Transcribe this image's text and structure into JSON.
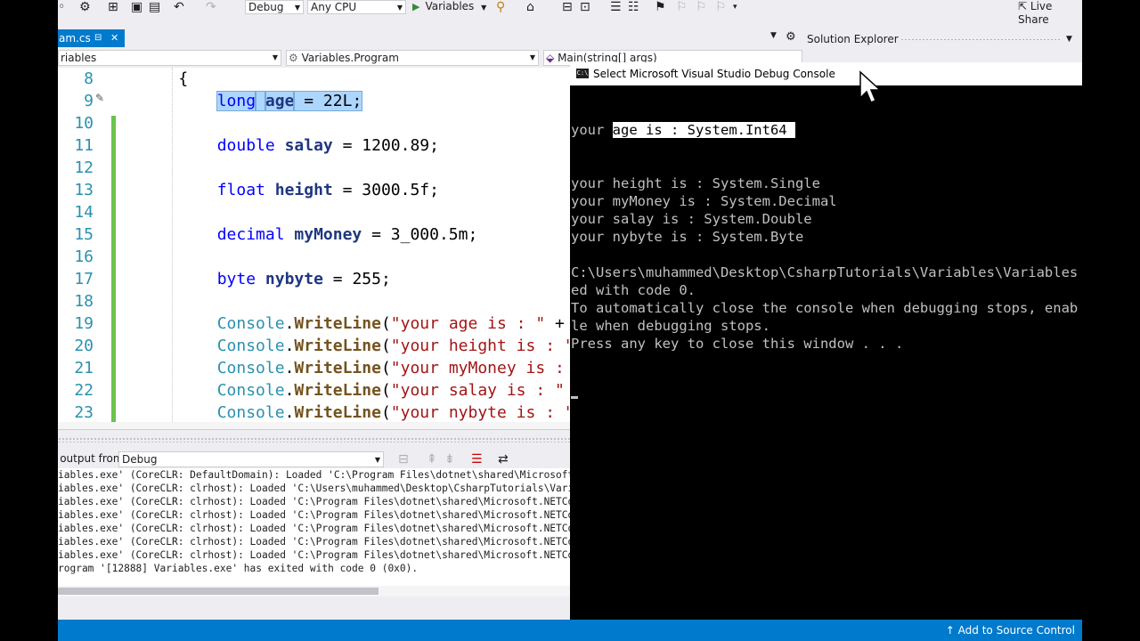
{
  "toolbar": {
    "config": "Debug",
    "platform": "Any CPU",
    "start_label": "Variables",
    "live_share": "Live Share"
  },
  "tabs": {
    "active_tab": "am.cs",
    "pin": "⊟",
    "close": "✕"
  },
  "navbar": {
    "project": "riables",
    "type": "Variables.Program",
    "member": "Main(string[] args)"
  },
  "editor": {
    "line_numbers": [
      "8",
      "9",
      "10",
      "11",
      "12",
      "13",
      "14",
      "15",
      "16",
      "17",
      "18",
      "19",
      "20",
      "21",
      "22",
      "23"
    ],
    "lines": [
      {
        "parts": [
          {
            "t": "    {",
            "c": ""
          }
        ]
      },
      {
        "parts": [
          {
            "t": "        ",
            "c": ""
          },
          {
            "t": "long",
            "c": "kw sel"
          },
          {
            "t": " ",
            "c": "sel"
          },
          {
            "t": "age",
            "c": "var sel"
          },
          {
            "t": " = 22L;",
            "c": "sel"
          }
        ]
      },
      {
        "parts": [
          {
            "t": "",
            "c": ""
          }
        ]
      },
      {
        "parts": [
          {
            "t": "        ",
            "c": ""
          },
          {
            "t": "double",
            "c": "kw"
          },
          {
            "t": " ",
            "c": ""
          },
          {
            "t": "salay",
            "c": "var"
          },
          {
            "t": " = 1200.89;",
            "c": ""
          }
        ]
      },
      {
        "parts": [
          {
            "t": "",
            "c": ""
          }
        ]
      },
      {
        "parts": [
          {
            "t": "        ",
            "c": ""
          },
          {
            "t": "float",
            "c": "kw"
          },
          {
            "t": " ",
            "c": ""
          },
          {
            "t": "height",
            "c": "var"
          },
          {
            "t": " = 3000.5f;",
            "c": ""
          }
        ]
      },
      {
        "parts": [
          {
            "t": "",
            "c": ""
          }
        ]
      },
      {
        "parts": [
          {
            "t": "        ",
            "c": ""
          },
          {
            "t": "decimal",
            "c": "kw"
          },
          {
            "t": " ",
            "c": ""
          },
          {
            "t": "myMoney",
            "c": "var"
          },
          {
            "t": " = 3_000.5m;",
            "c": ""
          }
        ]
      },
      {
        "parts": [
          {
            "t": "",
            "c": ""
          }
        ]
      },
      {
        "parts": [
          {
            "t": "        ",
            "c": ""
          },
          {
            "t": "byte",
            "c": "kw"
          },
          {
            "t": " ",
            "c": ""
          },
          {
            "t": "nybyte",
            "c": "var"
          },
          {
            "t": " = 255;",
            "c": ""
          }
        ]
      },
      {
        "parts": [
          {
            "t": "",
            "c": ""
          }
        ]
      },
      {
        "parts": [
          {
            "t": "        ",
            "c": ""
          },
          {
            "t": "Console",
            "c": "cls"
          },
          {
            "t": ".",
            "c": ""
          },
          {
            "t": "WriteLine",
            "c": "mth"
          },
          {
            "t": "(",
            "c": ""
          },
          {
            "t": "\"your age is : \"",
            "c": "str"
          },
          {
            "t": " +",
            "c": ""
          }
        ]
      },
      {
        "parts": [
          {
            "t": "        ",
            "c": ""
          },
          {
            "t": "Console",
            "c": "cls"
          },
          {
            "t": ".",
            "c": ""
          },
          {
            "t": "WriteLine",
            "c": "mth"
          },
          {
            "t": "(",
            "c": ""
          },
          {
            "t": "\"your height is : \"",
            "c": "str"
          }
        ]
      },
      {
        "parts": [
          {
            "t": "        ",
            "c": ""
          },
          {
            "t": "Console",
            "c": "cls"
          },
          {
            "t": ".",
            "c": ""
          },
          {
            "t": "WriteLine",
            "c": "mth"
          },
          {
            "t": "(",
            "c": ""
          },
          {
            "t": "\"your myMoney is :",
            "c": "str"
          }
        ]
      },
      {
        "parts": [
          {
            "t": "        ",
            "c": ""
          },
          {
            "t": "Console",
            "c": "cls"
          },
          {
            "t": ".",
            "c": ""
          },
          {
            "t": "WriteLine",
            "c": "mth"
          },
          {
            "t": "(",
            "c": ""
          },
          {
            "t": "\"your salay is : \"",
            "c": "str"
          }
        ]
      },
      {
        "parts": [
          {
            "t": "        ",
            "c": ""
          },
          {
            "t": "Console",
            "c": "cls"
          },
          {
            "t": ".",
            "c": ""
          },
          {
            "t": "WriteLine",
            "c": "mth"
          },
          {
            "t": "(",
            "c": ""
          },
          {
            "t": "\"your nybyte is : \"",
            "c": "str"
          }
        ]
      }
    ]
  },
  "output": {
    "label": "Show output from:",
    "source": "Debug",
    "lines": [
      "iables.exe' (CoreCLR: DefaultDomain): Loaded 'C:\\Program Files\\dotnet\\shared\\Microsoft.NE",
      "iables.exe' (CoreCLR: clrhost): Loaded 'C:\\Users\\muhammed\\Desktop\\CsharpTutorials\\Variable",
      "iables.exe' (CoreCLR: clrhost): Loaded 'C:\\Program Files\\dotnet\\shared\\Microsoft.NETCore.A",
      "iables.exe' (CoreCLR: clrhost): Loaded 'C:\\Program Files\\dotnet\\shared\\Microsoft.NETCore.A",
      "iables.exe' (CoreCLR: clrhost): Loaded 'C:\\Program Files\\dotnet\\shared\\Microsoft.NETCore.A",
      "iables.exe' (CoreCLR: clrhost): Loaded 'C:\\Program Files\\dotnet\\shared\\Microsoft.NETCore.A",
      "iables.exe' (CoreCLR: clrhost): Loaded 'C:\\Program Files\\dotnet\\shared\\Microsoft.NETCore.A",
      "rogram '[12888] Variables.exe' has exited with code 0 (0x0)."
    ]
  },
  "solution_explorer": {
    "title": "Solution Explorer"
  },
  "console": {
    "title": "Select Microsoft Visual Studio Debug Console",
    "icon_text": "C:\\",
    "first_line_prefix": "your ",
    "first_line_selected": "age is : System.Int64 ",
    "lines": [
      "your height is : System.Single",
      "your myMoney is : System.Decimal",
      "your salay is : System.Double",
      "your nybyte is : System.Byte",
      "",
      "C:\\Users\\muhammed\\Desktop\\CsharpTutorials\\Variables\\Variables",
      "ed with code 0.",
      "To automatically close the console when debugging stops, enab",
      "le when debugging stops.",
      "Press any key to close this window . . ."
    ]
  },
  "statusbar": {
    "source_control": "Add to Source Control"
  },
  "colors": {
    "accent": "#007acc",
    "change_bar": "#6bc24e",
    "selection": "#add6ff"
  }
}
